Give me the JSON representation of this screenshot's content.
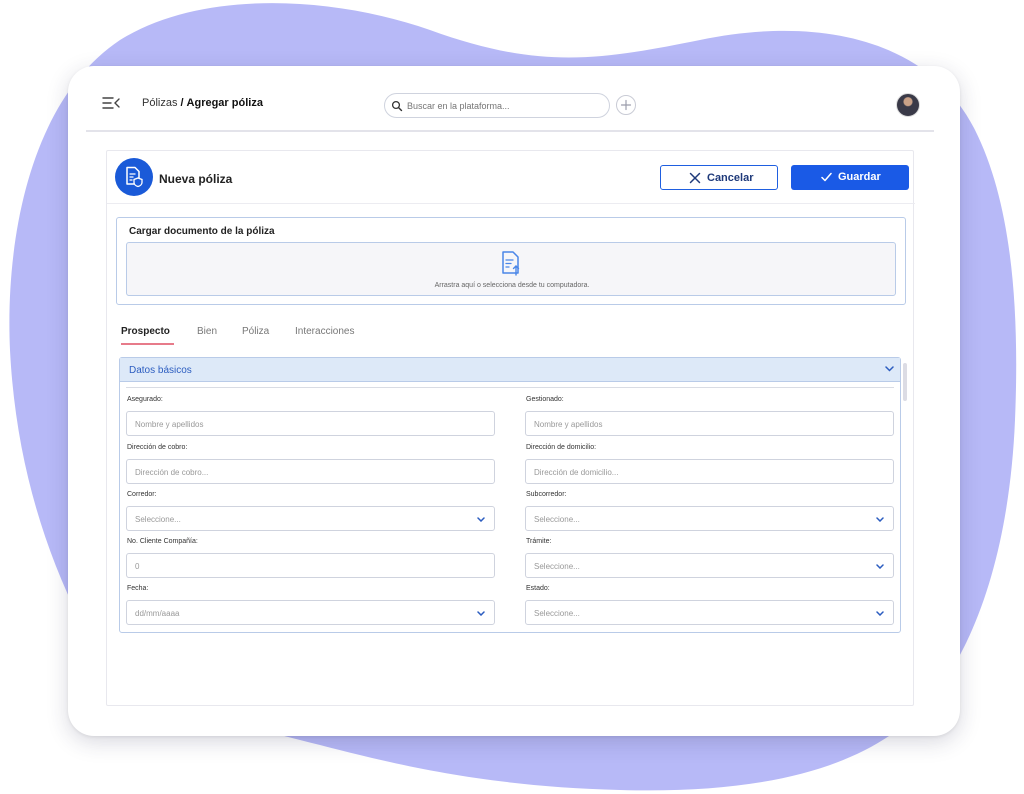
{
  "header": {
    "breadcrumb_parent": "Pólizas",
    "breadcrumb_separator": "/",
    "breadcrumb_current": "Agregar póliza",
    "search_placeholder": "Buscar en la plataforma..."
  },
  "panel": {
    "title": "Nueva póliza",
    "cancel_label": "Cancelar",
    "save_label": "Guardar"
  },
  "upload": {
    "title": "Cargar documento de la póliza",
    "hint": "Arrastra aquí o selecciona desde tu computadora."
  },
  "tabs": [
    {
      "label": "Prospecto",
      "active": true
    },
    {
      "label": "Bien",
      "active": false
    },
    {
      "label": "Póliza",
      "active": false
    },
    {
      "label": "Interacciones",
      "active": false
    }
  ],
  "section": {
    "title": "Datos básicos",
    "fields": [
      {
        "label": "Asegurado:",
        "placeholder": "Nombre y apellidos",
        "type": "text"
      },
      {
        "label": "Gestionado:",
        "placeholder": "Nombre y apellidos",
        "type": "text"
      },
      {
        "label": "Dirección de cobro:",
        "placeholder": "Dirección de cobro...",
        "type": "text"
      },
      {
        "label": "Dirección de domicilio:",
        "placeholder": "Dirección de domicilio...",
        "type": "text"
      },
      {
        "label": "Corredor:",
        "placeholder": "Seleccione...",
        "type": "select"
      },
      {
        "label": "Subcorredor:",
        "placeholder": "Seleccione...",
        "type": "select"
      },
      {
        "label": "No. Cliente Compañía:",
        "placeholder": "0",
        "type": "number"
      },
      {
        "label": "Trámite:",
        "placeholder": "Seleccione...",
        "type": "select"
      },
      {
        "label": "Fecha:",
        "placeholder": "dd/mm/aaaa",
        "type": "date"
      },
      {
        "label": "Estado:",
        "placeholder": "Seleccione...",
        "type": "select"
      }
    ]
  },
  "colors": {
    "accent": "#1a5ae6",
    "background_blob": "#b7b9f7",
    "tab_underline": "#e77b8a",
    "section_header": "#dde9f8"
  }
}
